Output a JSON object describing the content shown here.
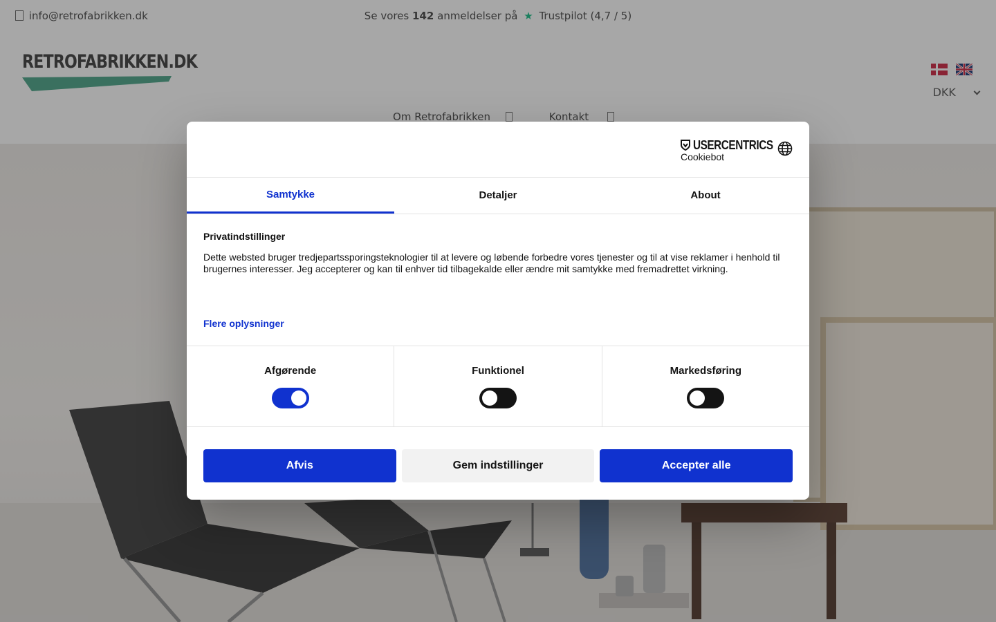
{
  "topbar": {
    "email": "info@retrofabrikken.dk",
    "trust_prefix": "Se vores",
    "trust_count": "142",
    "trust_mid": "anmeldelser på",
    "trust_star": "★",
    "trust_suffix": "Trustpilot (4,7 / 5)"
  },
  "header": {
    "logo_text": "RETROFABRIKKEN.DK",
    "currency": "DKK",
    "nav": {
      "about": "Om Retrofabrikken",
      "contact": "Kontakt"
    },
    "flags": [
      "flag-denmark-icon",
      "flag-uk-icon"
    ]
  },
  "dialog": {
    "brand_name": "USERCENTRICS",
    "brand_sub": "Cookiebot",
    "tabs": [
      {
        "label": "Samtykke",
        "active": true
      },
      {
        "label": "Detaljer",
        "active": false
      },
      {
        "label": "About",
        "active": false
      }
    ],
    "heading": "Privatindstillinger",
    "text": "Dette websted bruger tredjepartssporingsteknologier til at levere og løbende forbedre vores tjenester og til at vise reklamer i henhold til brugernes interesser. Jeg accepterer og kan til enhver tid tilbagekalde eller ændre mit samtykke med fremadrettet virkning.",
    "more_link": "Flere oplysninger",
    "toggles": [
      {
        "label": "Afgørende",
        "on": true
      },
      {
        "label": "Funktionel",
        "on": false
      },
      {
        "label": "Markedsføring",
        "on": false
      }
    ],
    "buttons": {
      "reject": "Afvis",
      "save": "Gem indstillinger",
      "accept": "Accepter alle"
    }
  },
  "colors": {
    "accent": "#1032cf",
    "logo_green": "#3a9b7c",
    "trustpilot_green": "#00b67a"
  }
}
